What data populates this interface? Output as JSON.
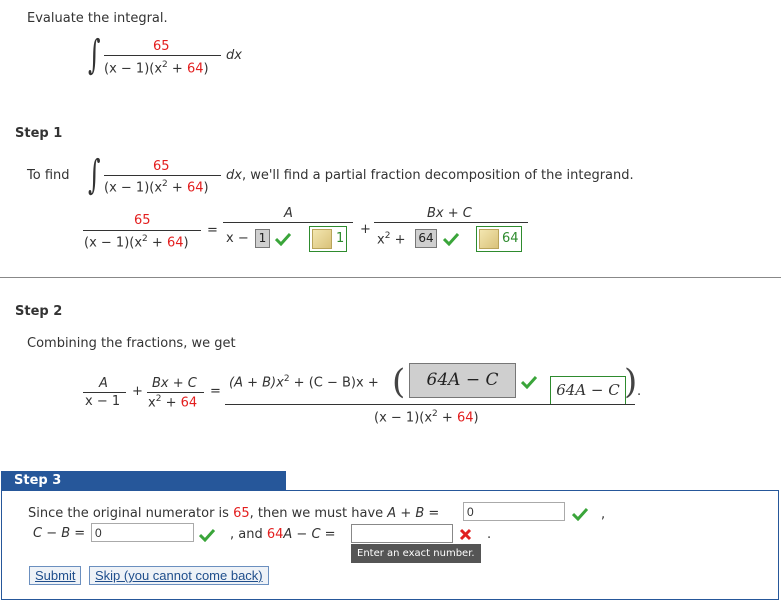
{
  "problem": {
    "prompt": "Evaluate the integral.",
    "numerator": "65",
    "denominator_left": "(x − 1)(x",
    "denominator_exp": "2",
    "denominator_right": " + ",
    "denominator_64": "64",
    "denominator_close": ")",
    "dx": "dx"
  },
  "step1": {
    "heading": "Step 1",
    "to_find": "To find",
    "numerator": "65",
    "tail_text": "dx, we'll find a partial fraction decomposition of the integrand.",
    "lhs_numerator": "65",
    "rhs1_numerator": "A",
    "rhs1_denominator": "x − ",
    "rhs1_answer": "1",
    "rhs1_key_value": "1",
    "rhs2_numerator": "Bx + C",
    "rhs2_denominator_a": "x",
    "rhs2_denominator_exp": "2",
    "rhs2_denominator_b": " + ",
    "rhs2_answer": "64",
    "rhs2_key_value": "64",
    "equals": "=",
    "plus": "+"
  },
  "step2": {
    "heading": "Step 2",
    "text": "Combining the fractions, we get",
    "a_num": "A",
    "a_den": "x − 1",
    "bc_num": "Bx + C",
    "bc_den_a": "x",
    "bc_den_exp": "2",
    "bc_den_b": " + ",
    "bc_den_64": "64",
    "plus": "+",
    "equals": "=",
    "combined_num": "(A + B)x",
    "combined_num_exp": "2",
    "combined_num_b": " + (C − B)x + ",
    "answer_box": "64A − C",
    "answer_key": "64A − C",
    "combined_den_a": "(x − 1)(x",
    "combined_den_exp": "2",
    "combined_den_b": " + ",
    "combined_den_64": "64",
    "combined_den_c": ")",
    "period": "."
  },
  "step3": {
    "heading": "Step 3",
    "line1_a": "Since the original numerator is ",
    "line1_num": "65",
    "line1_b": ", then we must have ",
    "line1_eq": "A + B = ",
    "input1_value": "0",
    "comma1": ",",
    "line2_eq": "C − B = ",
    "input2_value": "0",
    "comma2": ", and ",
    "line2_64": "64",
    "line2_rest": "A − C = ",
    "input3_value": "",
    "period": ".",
    "tooltip": "Enter an exact number.",
    "submit": "Submit",
    "skip": "Skip (you cannot come back)"
  },
  "colors": {
    "accent_blue": "#26579a",
    "highlight_red": "#e31e1e",
    "correct_green": "#3aa53a",
    "wrong_red": "#e02020"
  }
}
